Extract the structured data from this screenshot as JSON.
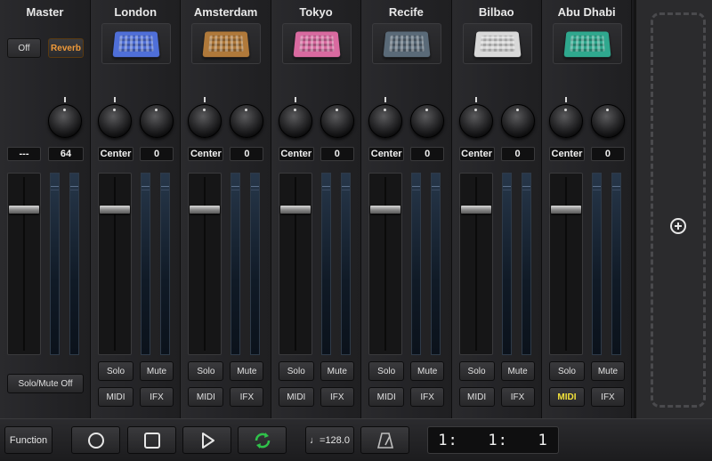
{
  "master": {
    "name": "Master",
    "off_label": "Off",
    "reverb_label": "Reverb",
    "pan_value": "---",
    "reverb_value": "64",
    "solo_mute_off_label": "Solo/Mute Off"
  },
  "tracks": [
    {
      "name": "London",
      "pan": "Center",
      "value": "0",
      "solo": "Solo",
      "mute": "Mute",
      "midi": "MIDI",
      "ifx": "IFX",
      "device_color": "#4f6fd8",
      "midi_active": false
    },
    {
      "name": "Amsterdam",
      "pan": "Center",
      "value": "0",
      "solo": "Solo",
      "mute": "Mute",
      "midi": "MIDI",
      "ifx": "IFX",
      "device_color": "#b0793a",
      "midi_active": false
    },
    {
      "name": "Tokyo",
      "pan": "Center",
      "value": "0",
      "solo": "Solo",
      "mute": "Mute",
      "midi": "MIDI",
      "ifx": "IFX",
      "device_color": "#d96aa0",
      "midi_active": false
    },
    {
      "name": "Recife",
      "pan": "Center",
      "value": "0",
      "solo": "Solo",
      "mute": "Mute",
      "midi": "MIDI",
      "ifx": "IFX",
      "device_color": "#5a6a78",
      "midi_active": false
    },
    {
      "name": "Bilbao",
      "pan": "Center",
      "value": "0",
      "solo": "Solo",
      "mute": "Mute",
      "midi": "MIDI",
      "ifx": "IFX",
      "device_color": "#d8d8d8",
      "midi_active": false
    },
    {
      "name": "Abu Dhabi",
      "pan": "Center",
      "value": "0",
      "solo": "Solo",
      "mute": "Mute",
      "midi": "MIDI",
      "ifx": "IFX",
      "device_color": "#2fa88e",
      "midi_active": true
    }
  ],
  "transport": {
    "function_label": "Function",
    "tempo_label": "♩=128.0",
    "position": "1:   1:   1"
  },
  "icons": {
    "record": "record-icon",
    "stop": "stop-icon",
    "play": "play-icon",
    "loop": "loop-icon",
    "metronome": "metronome-icon",
    "add": "add-track-icon"
  },
  "colors": {
    "midi_active_text": "#f3e23a",
    "loop_green": "#2fc24a"
  }
}
